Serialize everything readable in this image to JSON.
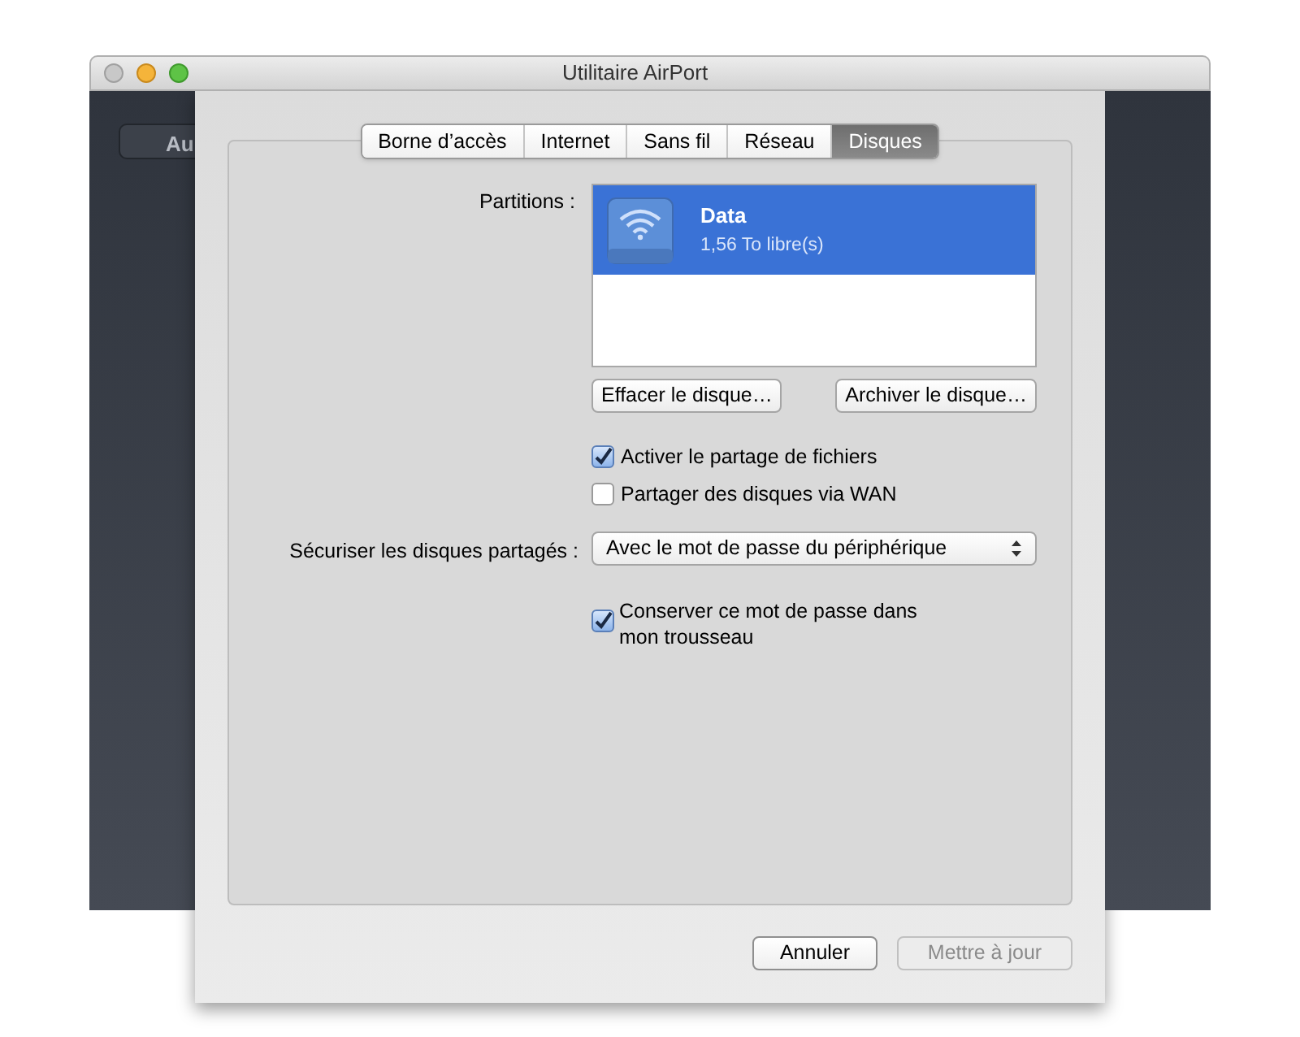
{
  "window": {
    "title": "Utilitaire AirPort"
  },
  "background_button": {
    "label": "Au"
  },
  "tabs": [
    {
      "label": "Borne d’accès",
      "selected": false
    },
    {
      "label": "Internet",
      "selected": false
    },
    {
      "label": "Sans fil",
      "selected": false
    },
    {
      "label": "Réseau",
      "selected": false
    },
    {
      "label": "Disques",
      "selected": true
    }
  ],
  "partitions": {
    "label": "Partitions :",
    "items": [
      {
        "name": "Data",
        "free": "1,56 To libre(s)",
        "selected": true
      }
    ]
  },
  "disk_buttons": [
    "Effacer le disque…",
    "Archiver le disque…"
  ],
  "sharing_options": [
    {
      "label": "Activer le partage de fichiers",
      "checked": true
    },
    {
      "label": "Partager des disques via WAN",
      "checked": false
    }
  ],
  "security": {
    "label": "Sécuriser les disques partagés :",
    "value": "Avec le mot de passe du périphérique"
  },
  "keychain": {
    "label": "Conserver ce mot de passe dans mon trousseau",
    "checked": true
  },
  "footer_buttons": [
    {
      "label": "Annuler",
      "disabled": false
    },
    {
      "label": "Mettre à jour",
      "disabled": true
    }
  ]
}
